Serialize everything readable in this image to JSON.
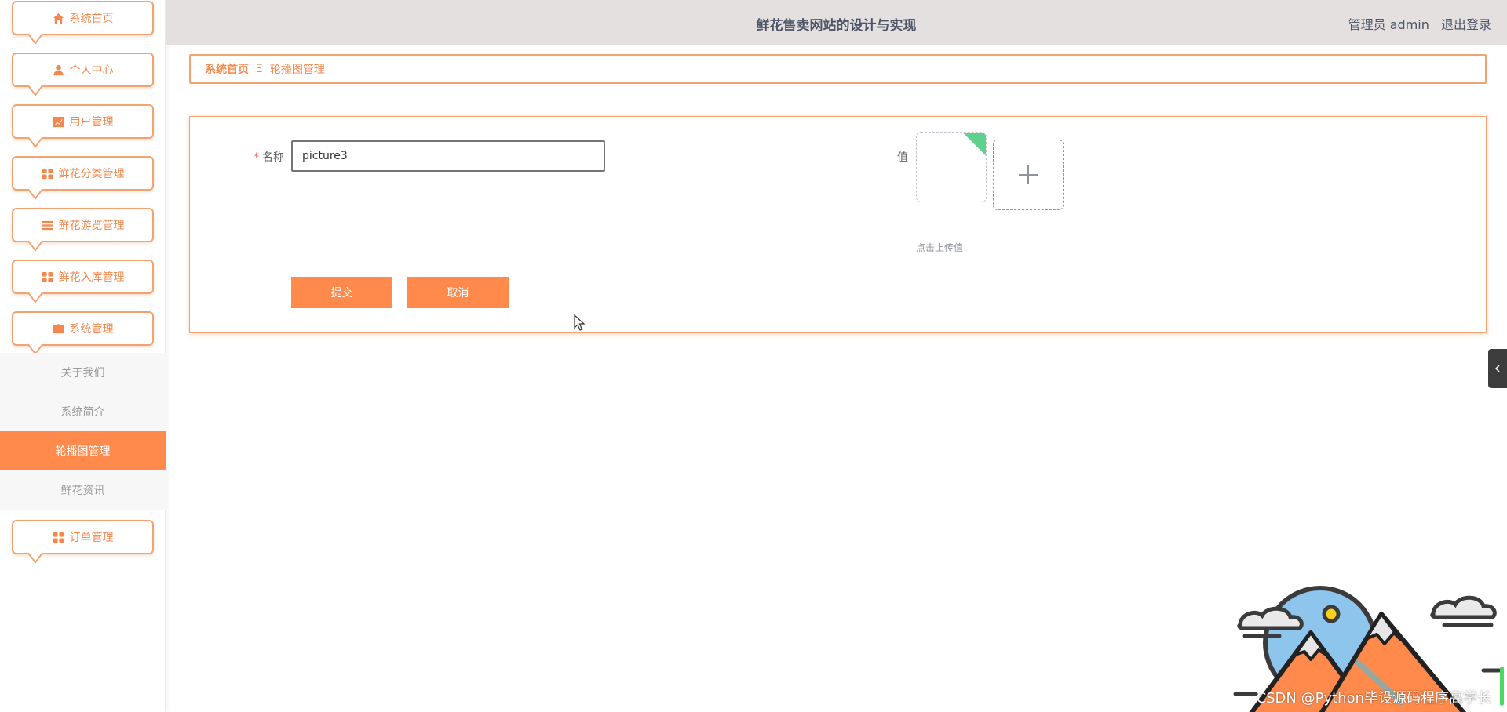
{
  "header": {
    "title": "鲜花售卖网站的设计与实现",
    "user_label": "管理员 admin",
    "logout_label": "退出登录"
  },
  "sidebar": {
    "items": [
      {
        "label": "系统首页",
        "icon": "home-icon"
      },
      {
        "label": "个人中心",
        "icon": "user-icon"
      },
      {
        "label": "用户管理",
        "icon": "chart-icon"
      },
      {
        "label": "鲜花分类管理",
        "icon": "grid-icon"
      },
      {
        "label": "鲜花游览管理",
        "icon": "list-icon"
      },
      {
        "label": "鲜花入库管理",
        "icon": "grid-icon"
      },
      {
        "label": "系统管理",
        "icon": "briefcase-icon"
      }
    ],
    "submenu": [
      {
        "label": "关于我们",
        "active": false
      },
      {
        "label": "系统简介",
        "active": false
      },
      {
        "label": "轮播图管理",
        "active": true
      },
      {
        "label": "鲜花资讯",
        "active": false
      }
    ],
    "bottom_item": {
      "label": "订单管理",
      "icon": "grid-icon"
    }
  },
  "breadcrumb": {
    "home": "系统首页",
    "separator": "Ξ",
    "current": "轮播图管理"
  },
  "form": {
    "name_label": "名称",
    "required_mark": "*",
    "name_value": "picture3",
    "value_label": "值",
    "upload_tip": "点击上传值",
    "submit_label": "提交",
    "cancel_label": "取消"
  },
  "watermark": "CSDN @Python毕设源码程序高学长",
  "colors": {
    "accent": "#ff8a4b",
    "border": "#f4a26f",
    "header_bg": "#e4e0e0"
  }
}
